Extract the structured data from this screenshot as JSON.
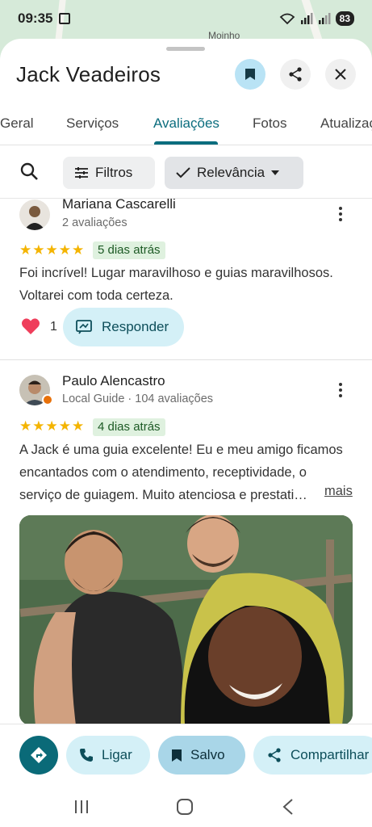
{
  "status_bar": {
    "time": "09:35",
    "battery": "83"
  },
  "map": {
    "label": "Moinho"
  },
  "place": {
    "title": "Jack Veadeiros"
  },
  "tabs": [
    {
      "label": "Geral"
    },
    {
      "label": "Serviços"
    },
    {
      "label": "Avaliações",
      "active": true
    },
    {
      "label": "Fotos"
    },
    {
      "label": "Atualizações"
    }
  ],
  "filters": {
    "filters_label": "Filtros",
    "sort_label": "Relevância"
  },
  "reviews": [
    {
      "name": "Mariana Cascarelli",
      "meta": "2 avaliações",
      "rating": 5,
      "date": "5 dias atrás",
      "text_line1": "Foi incrível! Lugar maravilhoso e guias maravilhosos.",
      "text_line2": "Voltarei com toda certeza.",
      "likes": "1",
      "reply_label": "Responder"
    },
    {
      "name": "Paulo Alencastro",
      "meta": "Local Guide · 104 avaliações",
      "rating": 5,
      "date": "4 dias atrás",
      "text_line1": "A Jack é uma guia excelente! Eu e meu amigo ficamos",
      "text_line2": "encantados com o atendimento, receptividade, o",
      "text_line3": "serviço de guiagem. Muito atenciosa e prestati…",
      "more_label": "mais"
    }
  ],
  "actions": {
    "call": "Ligar",
    "saved": "Salvo",
    "share": "Compartilhar"
  },
  "colors": {
    "accent": "#0b6d7e",
    "chip_bg": "#d4f0f7",
    "star": "#f4b400"
  }
}
